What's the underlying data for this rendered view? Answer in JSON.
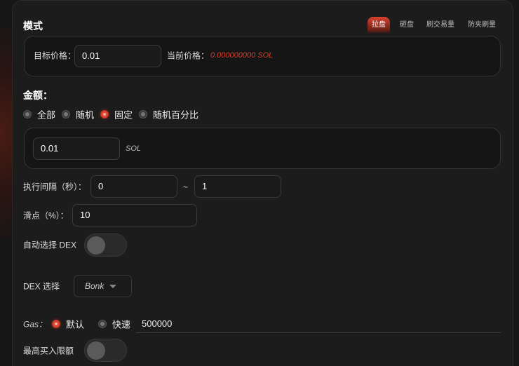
{
  "mode": {
    "title": "模式",
    "tabs": [
      {
        "label": "拉盘",
        "active": true
      },
      {
        "label": "砸盘"
      },
      {
        "label": "刷交易量"
      },
      {
        "label": "防夹刷量"
      }
    ],
    "target_price_label": "目标价格：",
    "target_price_value": "0.01",
    "current_price_label": "当前价格：",
    "current_price_value": "0.000000000 SOL"
  },
  "amount": {
    "title": "金额：",
    "options": [
      "全部",
      "随机",
      "固定",
      "随机百分比"
    ],
    "selected": "固定",
    "value": "0.01",
    "unit": "SOL"
  },
  "interval": {
    "label": "执行间隔（秒）：",
    "min": "0",
    "separator": "~",
    "max": "1"
  },
  "slippage": {
    "label": "滑点（%）：",
    "value": "10"
  },
  "auto_dex": {
    "label": "自动选择 DEX",
    "on": false
  },
  "dex": {
    "label": "DEX 选择",
    "value": "Bonk"
  },
  "gas": {
    "label": "Gas：",
    "options": [
      "默认",
      "快速"
    ],
    "selected": "默认",
    "value": "500000"
  },
  "max_buy": {
    "label": "最高买入限额",
    "on": false
  },
  "colors": {
    "accent": "#e0442e",
    "price": "#d0442e"
  }
}
